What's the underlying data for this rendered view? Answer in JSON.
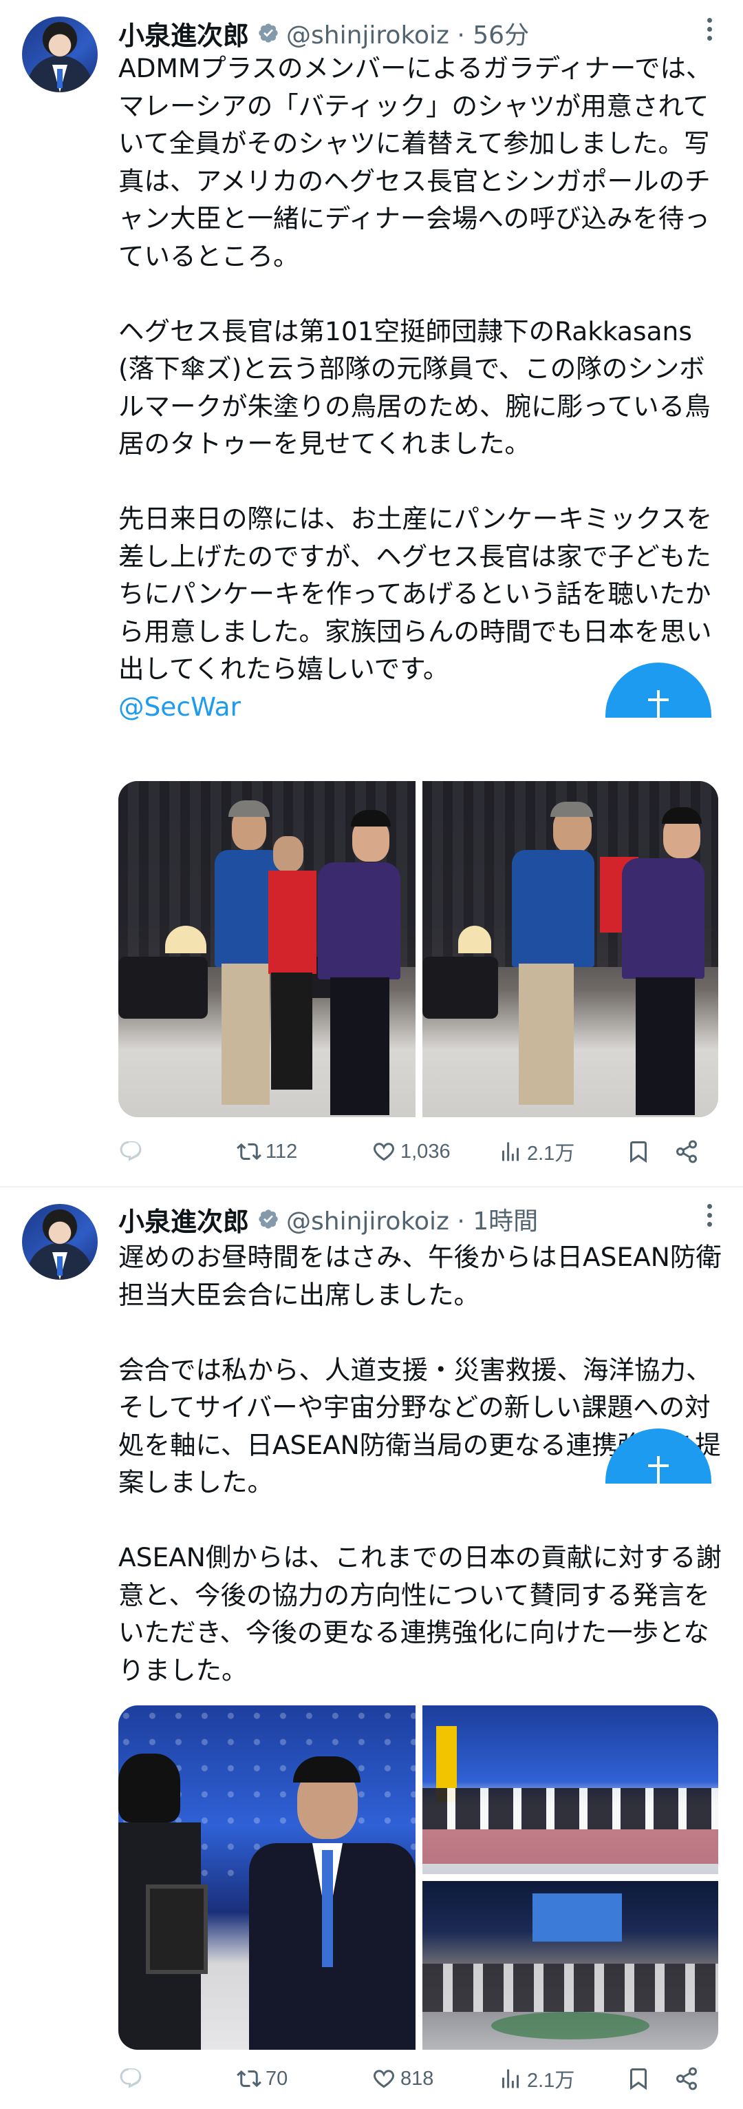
{
  "tweets": [
    {
      "author_name": "小泉進次郎",
      "handle_time": "@shinjirokoiz · 56分",
      "text": "ADMMプラスのメンバーによるガラディナーでは、マレーシアの「バティック」のシャツが用意されていて全員がそのシャツに着替えて参加しました。写真は、アメリカのヘグセス長官とシンガポールのチャン大臣と一緒にディナー会場への呼び込みを待っているところ。\n\nヘグセス長官は第101空挺師団隷下のRakkasans (落下傘ズ)と云う部隊の元隊員で、この隊のシンボルマークが朱塗りの鳥居のため、腕に彫っている鳥居のタトゥーを見せてくれました。\n\n先日来日の際には、お土産にパンケーキミックスを差し上げたのですが、ヘグセス長官は家で子どもたちにパンケーキを作ってあげるという話を聴いたから用意しました。家族団らんの時間でも日本を思い出してくれたら嬉しいです。",
      "mention": "@SecWar",
      "replies": "",
      "reposts": "112",
      "likes": "1,036",
      "views": "2.1万"
    },
    {
      "author_name": "小泉進次郎",
      "handle_time": "@shinjirokoiz · 1時間",
      "text": "遅めのお昼時間をはさみ、午後からは日ASEAN防衛担当大臣会合に出席しました。\n\n会合では私から、人道支援・災害救援、海洋協力、そしてサイバーや宇宙分野などの新しい課題への対処を軸に、日ASEAN防衛当局の更なる連携強化を提案しました。\n\nASEAN側からは、これまでの日本の貢献に対する謝意と、今後の協力の方向性について賛同する発言をいただき、今後の更なる連携強化に向けた一歩となりました。",
      "replies": "",
      "reposts": "70",
      "likes": "818",
      "views": "2.1万"
    }
  ],
  "icons": {
    "verified": "verified-badge-icon",
    "reply": "reply-icon",
    "repost": "repost-icon",
    "like": "heart-icon",
    "views": "views-chart-icon",
    "bookmark": "bookmark-icon",
    "share": "share-icon",
    "more": "more-dots-icon",
    "compose": "compose-plus-icon"
  },
  "colors": {
    "accent": "#1d9bf0",
    "text": "#0f1419",
    "muted": "#536471"
  }
}
